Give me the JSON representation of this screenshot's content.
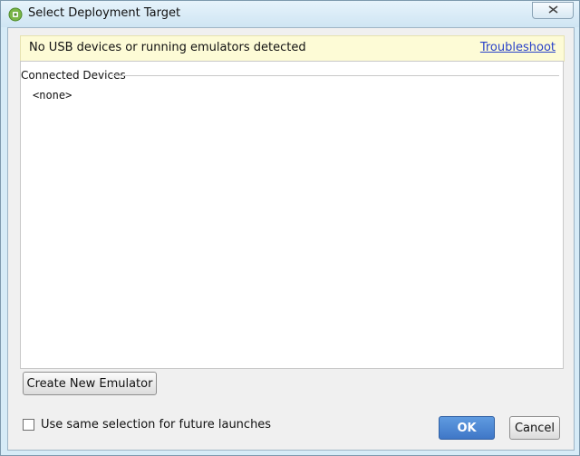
{
  "window": {
    "title": "Select Deployment Target",
    "close_icon": "close-icon",
    "app_icon": "android-studio-icon"
  },
  "banner": {
    "message": "No USB devices or running emulators detected",
    "link_label": "Troubleshoot"
  },
  "devices": {
    "group_label": "Connected Devices",
    "items": [
      "<none>"
    ]
  },
  "actions": {
    "create_emulator_label": "Create New Emulator",
    "checkbox_label": "Use same selection for future launches",
    "checkbox_checked": false,
    "ok_label": "OK",
    "cancel_label": "Cancel"
  },
  "colors": {
    "banner_bg": "#fdfbd6",
    "link": "#2a43c9",
    "ok_button": "#3f77c7"
  }
}
